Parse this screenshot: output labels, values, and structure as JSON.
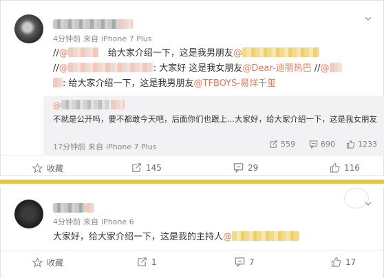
{
  "post1": {
    "meta": {
      "time": "4分钟前",
      "via": "来自",
      "device": "iPhone 7 Plus"
    },
    "lines": {
      "l1_prefix": "//",
      "l1_at": "@",
      "l1_text": "给大家介绍一下，这是我男朋友",
      "l1_at2": "@",
      "l2_prefix": "//",
      "l2_at": "@",
      "l2_text": ": 大家好 这是我女朋友",
      "l2_mention": "@Dear-迪丽热巴",
      "l2_sep": "//",
      "l2_at3": "@",
      "l3_text": ": 给大家介绍一下，这是我男朋友",
      "l3_mention": "@TFBOYS-易烊千玺"
    },
    "quote": {
      "at": "@",
      "text": "不就是公开吗，要不都敢今天吧，后面你们也跟上...大家好，给大家介绍一下，这是我女朋友",
      "meta_time": "17分钟前",
      "meta_via": "来自",
      "meta_device": "iPhone 7 Plus",
      "reposts": "559",
      "comments": "690",
      "likes": "1233"
    },
    "actions": {
      "favorite": "收藏",
      "repost": "145",
      "comment": "29",
      "like": "116"
    }
  },
  "post2": {
    "meta": {
      "time": "4分钟前",
      "via": "来自",
      "device": "iPhone 6"
    },
    "text": "大家好，给大家介绍一下，这是我的主持人",
    "at": "@",
    "actions": {
      "favorite": "收藏",
      "repost": "1",
      "comment": "7",
      "like": "17"
    }
  },
  "colors": {
    "accent": "#eb7350",
    "divider": "#e7c44a",
    "quote_bg": "#f2f2f5"
  },
  "icons": [
    "star-icon",
    "repost-icon",
    "comment-icon",
    "like-icon",
    "chevron-down-icon"
  ]
}
